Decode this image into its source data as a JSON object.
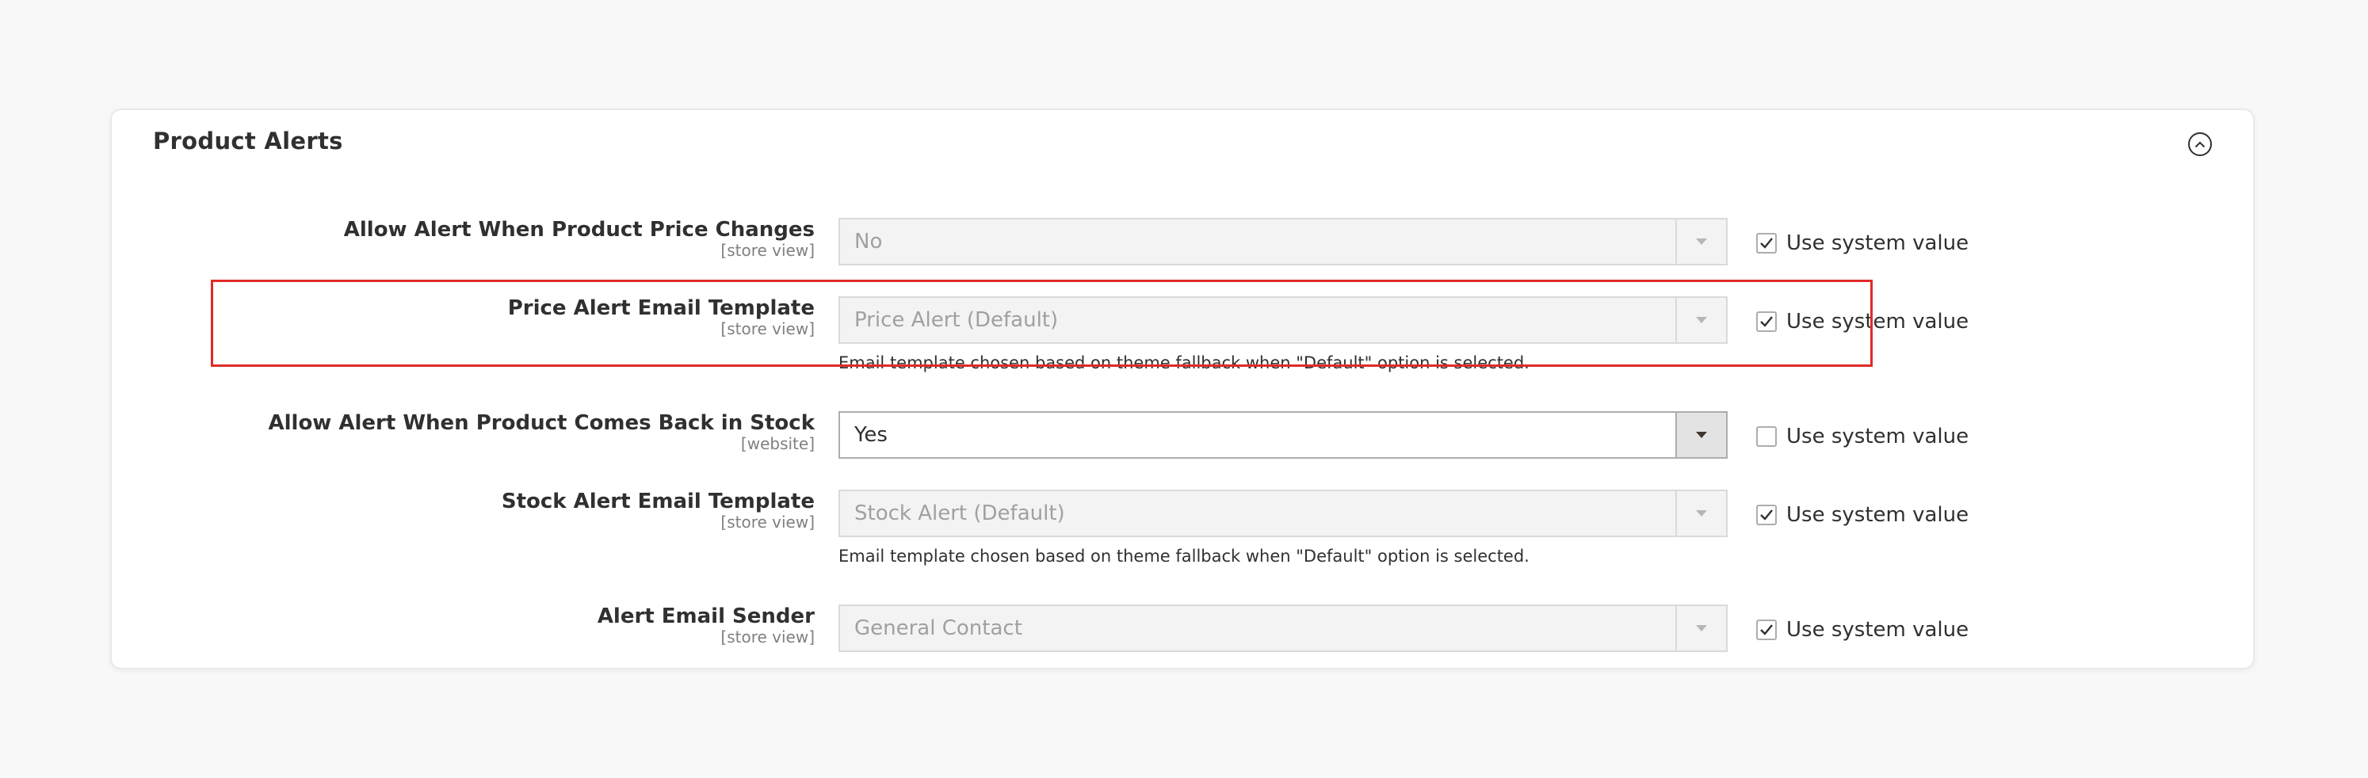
{
  "panel": {
    "title": "Product Alerts"
  },
  "rows": [
    {
      "label": "Allow Alert When Product Price Changes",
      "scope": "[store view]",
      "value": "No",
      "use_system_value": true,
      "hint": ""
    },
    {
      "label": "Price Alert Email Template",
      "scope": "[store view]",
      "value": "Price Alert (Default)",
      "use_system_value": true,
      "hint": "Email template chosen based on theme fallback when \"Default\" option is selected."
    },
    {
      "label": "Allow Alert When Product Comes Back in Stock",
      "scope": "[website]",
      "value": "Yes",
      "use_system_value": false,
      "hint": ""
    },
    {
      "label": "Stock Alert Email Template",
      "scope": "[store view]",
      "value": "Stock Alert (Default)",
      "use_system_value": true,
      "hint": "Email template chosen based on theme fallback when \"Default\" option is selected."
    },
    {
      "label": "Alert Email Sender",
      "scope": "[store view]",
      "value": "General Contact",
      "use_system_value": true,
      "hint": ""
    }
  ],
  "system_value_label": "Use system value",
  "colors": {
    "highlight": "#e02b27",
    "background": "#f8f8f8",
    "disabled_field": "#f3f3f3"
  },
  "icons": {
    "collapse": "chevron-up-circle-icon",
    "dropdown": "triangle-down-icon",
    "check": "checkmark-icon"
  }
}
